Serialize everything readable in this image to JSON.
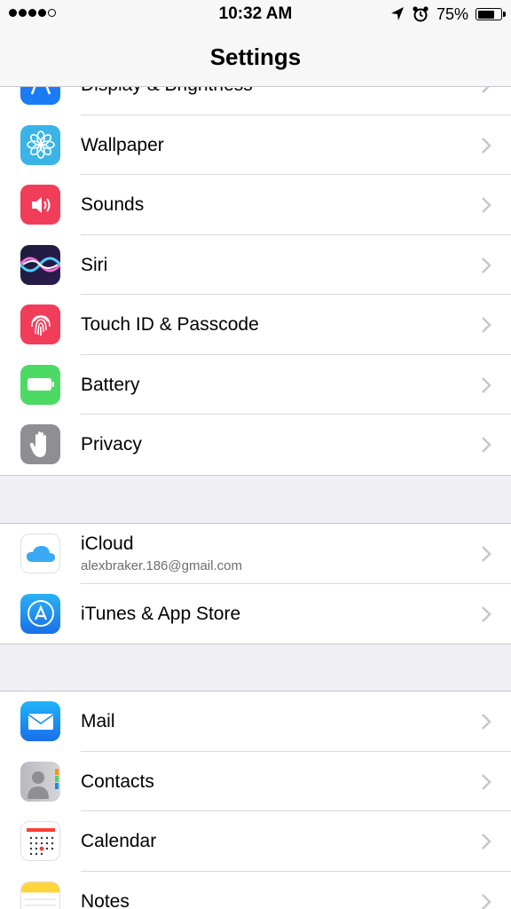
{
  "status_bar": {
    "signal_dots_filled": 4,
    "signal_dots_total": 5,
    "time": "10:32 AM",
    "location_icon": "location-arrow-icon",
    "alarm_icon": "alarm-clock-icon",
    "battery_percent": "75%",
    "battery_level": 0.75
  },
  "nav": {
    "title": "Settings"
  },
  "groups": [
    {
      "items": [
        {
          "label": "Display & Brightness",
          "icon": "display-icon",
          "color": "#1a7cf5"
        },
        {
          "label": "Wallpaper",
          "icon": "wallpaper-icon",
          "color": "#3ab4e6"
        },
        {
          "label": "Sounds",
          "icon": "speaker-icon",
          "color": "#f23d5a"
        },
        {
          "label": "Siri",
          "icon": "siri-icon",
          "color": "#1c1c3a"
        },
        {
          "label": "Touch ID & Passcode",
          "icon": "fingerprint-icon",
          "color": "#f23d5a"
        },
        {
          "label": "Battery",
          "icon": "battery-icon",
          "color": "#4cd964"
        },
        {
          "label": "Privacy",
          "icon": "hand-icon",
          "color": "#8e8e93"
        }
      ]
    },
    {
      "items": [
        {
          "label": "iCloud",
          "sublabel": "alexbraker.186@gmail.com",
          "icon": "icloud-icon",
          "color": "#ffffff"
        },
        {
          "label": "iTunes & App Store",
          "icon": "app-store-icon",
          "color": "#1a8cf0"
        }
      ]
    },
    {
      "items": [
        {
          "label": "Mail",
          "icon": "mail-icon",
          "color": "#1f8ff5"
        },
        {
          "label": "Contacts",
          "icon": "contacts-icon",
          "color": "#c7c7cc"
        },
        {
          "label": "Calendar",
          "icon": "calendar-icon",
          "color": "#ffffff"
        },
        {
          "label": "Notes",
          "icon": "notes-icon",
          "color": "#ffd53c"
        }
      ]
    }
  ]
}
